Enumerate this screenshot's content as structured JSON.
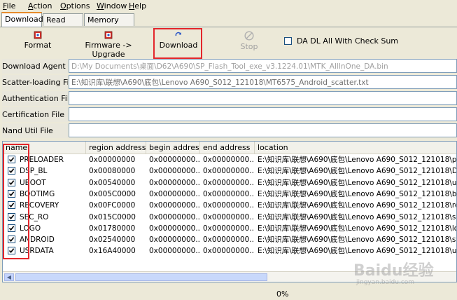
{
  "menu": [
    {
      "first": "F",
      "rest": "ile"
    },
    {
      "first": "A",
      "rest": "ction"
    },
    {
      "first": "O",
      "rest": "ptions"
    },
    {
      "first": "W",
      "rest": "indow"
    },
    {
      "first": "H",
      "rest": "elp"
    }
  ],
  "tabs": [
    "Download",
    "Read back",
    "Memory Test"
  ],
  "toolbar": {
    "format": "Format",
    "firmware_upgrade": "Firmware -> Upgrade",
    "download": "Download",
    "stop": "Stop",
    "checksum_label": "DA DL All With Check Sum"
  },
  "fields": {
    "download_agent": {
      "label": "Download Agent",
      "value": "D:\\My Documents\\桌面\\D62\\A690\\SP_Flash_Tool_exe_v3.1224.01\\MTK_AllInOne_DA.bin"
    },
    "scatter_loading": {
      "label": "Scatter-loading File",
      "value": "E:\\知识库\\联想\\A690\\底包\\Lenovo A690_S012_121018\\MT6575_Android_scatter.txt"
    },
    "authentication": {
      "label": "Authentication File",
      "value": ""
    },
    "certification": {
      "label": "Certification File",
      "value": ""
    },
    "nand_util": {
      "label": "Nand Util File",
      "value": ""
    }
  },
  "table": {
    "headers": [
      "name",
      "region address",
      "begin address",
      "end address",
      "location"
    ],
    "rows": [
      {
        "name": "PRELOADER",
        "region": "0x00000000",
        "begin": "0x00000000...",
        "end": "0x00000000...",
        "location": "E:\\知识库\\联想\\A690\\底包\\Lenovo A690_S012_121018\\pre"
      },
      {
        "name": "DSP_BL",
        "region": "0x00080000",
        "begin": "0x00000000...",
        "end": "0x00000000...",
        "location": "E:\\知识库\\联想\\A690\\底包\\Lenovo A690_S012_121018\\DS"
      },
      {
        "name": "UBOOT",
        "region": "0x00540000",
        "begin": "0x00000000...",
        "end": "0x00000000...",
        "location": "E:\\知识库\\联想\\A690\\底包\\Lenovo A690_S012_121018\\ub"
      },
      {
        "name": "BOOTIMG",
        "region": "0x005C0000",
        "begin": "0x00000000...",
        "end": "0x00000000...",
        "location": "E:\\知识库\\联想\\A690\\底包\\Lenovo A690_S012_121018\\bo"
      },
      {
        "name": "RECOVERY",
        "region": "0x00FC0000",
        "begin": "0x00000000...",
        "end": "0x00000000...",
        "location": "E:\\知识库\\联想\\A690\\底包\\Lenovo A690_S012_121018\\rec"
      },
      {
        "name": "SEC_RO",
        "region": "0x015C0000",
        "begin": "0x00000000...",
        "end": "0x00000000...",
        "location": "E:\\知识库\\联想\\A690\\底包\\Lenovo A690_S012_121018\\sec"
      },
      {
        "name": "LOGO",
        "region": "0x01780000",
        "begin": "0x00000000...",
        "end": "0x00000000...",
        "location": "E:\\知识库\\联想\\A690\\底包\\Lenovo A690_S012_121018\\log"
      },
      {
        "name": "ANDROID",
        "region": "0x02540000",
        "begin": "0x00000000...",
        "end": "0x00000000...",
        "location": "E:\\知识库\\联想\\A690\\底包\\Lenovo A690_S012_121018\\sy"
      },
      {
        "name": "USRDATA",
        "region": "0x16A40000",
        "begin": "0x00000000...",
        "end": "0x00000000...",
        "location": "E:\\知识库\\联想\\A690\\底包\\Lenovo A690_S012_121018\\us"
      }
    ]
  },
  "status": {
    "progress": "0%"
  },
  "watermark": {
    "brand": "Baidu经验",
    "url": "jingyan.baidu.com"
  },
  "colors": {
    "highlight": "#e3262b",
    "tab_accent": "#e68b2c",
    "field_border": "#7f9db9"
  }
}
